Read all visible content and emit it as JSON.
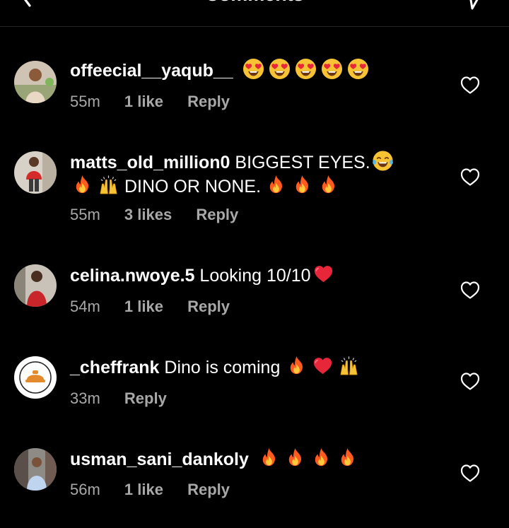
{
  "header": {
    "title": "Comments",
    "back_icon": "chevron-left-icon",
    "share_icon": "send-icon"
  },
  "colors": {
    "background": "#000000",
    "text": "#ffffff",
    "meta_text": "#a8a8a8",
    "divider": "#262626"
  },
  "comments": [
    {
      "username": "offeecial__yaqub__",
      "text": "",
      "emojis": [
        "heart-eyes-emoji",
        "heart-eyes-emoji",
        "heart-eyes-emoji",
        "heart-eyes-emoji",
        "heart-eyes-emoji"
      ],
      "time": "55m",
      "likes": "1 like",
      "reply": "Reply"
    },
    {
      "username": "matts_old_million0",
      "text_part1": "BIGGEST EYES.",
      "text_part2": "DINO OR NONE.",
      "time": "55m",
      "likes": "3 likes",
      "reply": "Reply"
    },
    {
      "username": "celina.nwoye.5",
      "text": "Looking 10/10",
      "time": "54m",
      "likes": "1 like",
      "reply": "Reply"
    },
    {
      "username": "_cheffrank",
      "text": "Dino is coming",
      "time": "33m",
      "reply": "Reply"
    },
    {
      "username": "usman_sani_dankoly",
      "text": "",
      "time": "56m",
      "likes": "1 like",
      "reply": "Reply"
    }
  ]
}
